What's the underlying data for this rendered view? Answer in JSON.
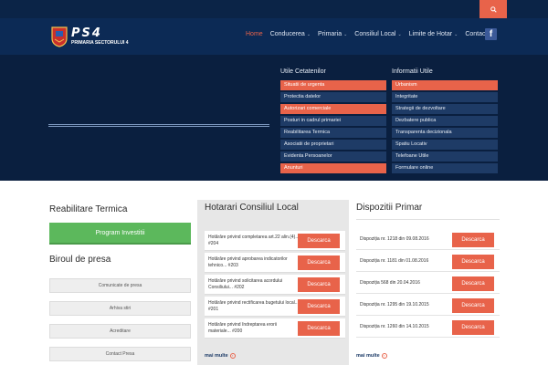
{
  "header": {
    "logo_text": "PS4",
    "logo_subtitle": "PRIMARIA SECTORULUI 4",
    "nav": [
      {
        "label": "Home",
        "active": true,
        "dropdown": false
      },
      {
        "label": "Conducerea",
        "active": false,
        "dropdown": true
      },
      {
        "label": "Primaria",
        "active": false,
        "dropdown": true
      },
      {
        "label": "Consiliul Local",
        "active": false,
        "dropdown": true
      },
      {
        "label": "Limite de Hotar",
        "active": false,
        "dropdown": true
      },
      {
        "label": "Contact",
        "active": false,
        "dropdown": false
      }
    ],
    "search_icon": "search-icon",
    "facebook_icon": "facebook-icon"
  },
  "hero": {
    "col1_title": "Utile Cetatenilor",
    "col1_items": [
      {
        "label": "Situatii de urgenta",
        "highlight": true
      },
      {
        "label": "Protectia datelor",
        "highlight": false
      },
      {
        "label": "Autorizari comerciale",
        "highlight": true
      },
      {
        "label": "Posturi in cadrul primariei",
        "highlight": false
      },
      {
        "label": "Reabilitarea Termica",
        "highlight": false
      },
      {
        "label": "Asociatii de proprietari",
        "highlight": false
      },
      {
        "label": "Evidenta Persoanelor",
        "highlight": false
      },
      {
        "label": "Anunturi",
        "highlight": true
      }
    ],
    "col2_title": "Informatii Utile",
    "col2_items": [
      {
        "label": "Urbanism",
        "highlight": true
      },
      {
        "label": "Integritate",
        "highlight": false
      },
      {
        "label": "Strategii de dezvoltare",
        "highlight": false
      },
      {
        "label": "Dezbatere publica",
        "highlight": false
      },
      {
        "label": "Transparenta decizionala",
        "highlight": false
      },
      {
        "label": "Spatiu Locativ",
        "highlight": false
      },
      {
        "label": "Telefoane Utile",
        "highlight": false
      },
      {
        "label": "Formulare online",
        "highlight": false
      }
    ]
  },
  "left": {
    "title1": "Reabilitare Termica",
    "green_button": "Program Investitii",
    "title2": "Biroul de presa",
    "press_buttons": [
      "Comunicate de presa",
      "Arhiva stiri",
      "Acreditare",
      "Contact Presa"
    ]
  },
  "hcl": {
    "title": "Hotarari Consiliul Local",
    "rows": [
      {
        "text": "Hotărâre privind completarea art.22 alin.(4)... #204",
        "button": "Descarca"
      },
      {
        "text": "Hotărâre privind aprobarea indicatorilor tehnico... #203",
        "button": "Descarca"
      },
      {
        "text": "Hotărâre privind solicitarea acordului Consiliului... #202",
        "button": "Descarca"
      },
      {
        "text": "Hotărâre privind rectificarea bugetului local... #201",
        "button": "Descarca"
      },
      {
        "text": "Hotărâre privind îndreptarea erorii materiale... #200",
        "button": "Descarca"
      }
    ],
    "more": "mai multe"
  },
  "dp": {
    "title": "Dispozitii Primar",
    "rows": [
      {
        "text": "Dispoziția nr. 1218 din 09.08.2016",
        "button": "Descarca"
      },
      {
        "text": "Dispoziția nr. 1181 din 01.08.2016",
        "button": "Descarca"
      },
      {
        "text": "Dispoziția 568 din 20.04.2016",
        "button": "Descarca"
      },
      {
        "text": "Dispoziția nr. 1295 din 19.10.2015",
        "button": "Descarca"
      },
      {
        "text": "Dispoziția nr. 1260 din 14.10.2015",
        "button": "Descarca"
      }
    ],
    "more": "mai multe"
  },
  "colors": {
    "accent": "#e8634a",
    "navy": "#0c2a55",
    "green": "#5cb85c"
  }
}
